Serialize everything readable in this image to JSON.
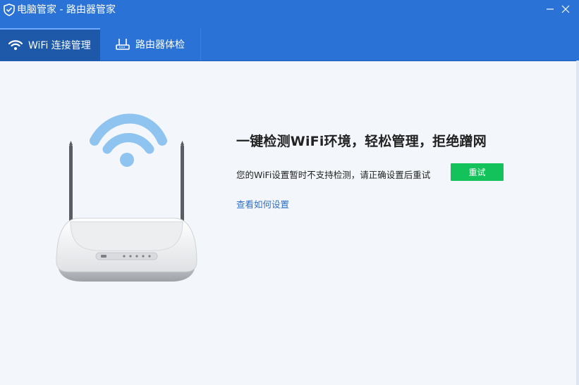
{
  "window": {
    "title": "电脑管家 - 路由器管家",
    "controls": {
      "minimize_icon": "minimize-icon",
      "close_icon": "close-icon"
    }
  },
  "tabs": [
    {
      "label": "WiFi 连接管理",
      "icon": "wifi-icon",
      "active": true
    },
    {
      "label": "路由器体检",
      "icon": "router-icon",
      "active": false
    }
  ],
  "main": {
    "headline": "一键检测WiFi环境，轻松管理，拒绝蹭网",
    "status_message": "您的WiFi设置暂时不支持检测，请正确设置后重试",
    "retry_button": "重试",
    "help_link": "查看如何设置",
    "illustration_icon": "router-wifi-illustration"
  },
  "colors": {
    "titlebar": "#2a72d6",
    "active_tab": "#1d58a9",
    "retry_button": "#13c25a",
    "link": "#2c6fc5",
    "wifi_blue": "#8fc3f0"
  }
}
